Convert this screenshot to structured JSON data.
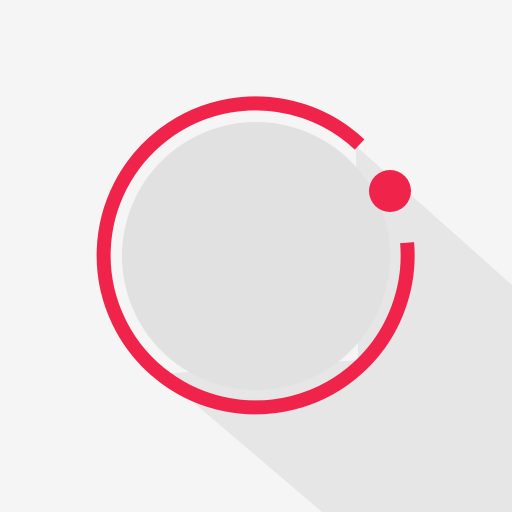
{
  "app_icon": {
    "name": "ring-with-dot-logo",
    "colors": {
      "background": "#f5f5f5",
      "long_shadow": "#e6e6e6",
      "disc_fill": "#e1e1e1",
      "ring_stroke": "#f0234a",
      "dot_fill": "#f0234a"
    }
  }
}
